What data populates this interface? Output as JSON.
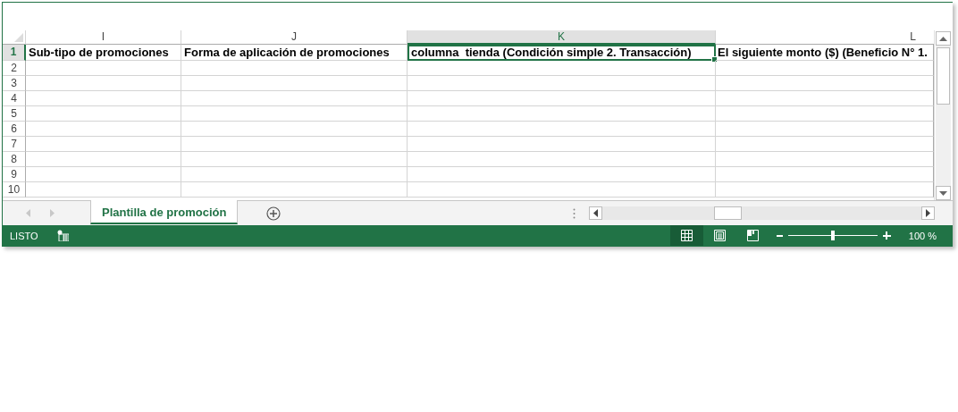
{
  "columns": [
    {
      "label": "I",
      "selected": false
    },
    {
      "label": "J",
      "selected": false
    },
    {
      "label": "K",
      "selected": true
    },
    {
      "label": "L",
      "selected": false
    }
  ],
  "rows": [
    {
      "number": "1",
      "selected": true,
      "cells": [
        {
          "text": "Sub-tipo de promociones",
          "selected": false
        },
        {
          "text": "Forma de aplicación de promociones",
          "selected": false
        },
        {
          "text": "columna  tienda (Condición simple 2. Transacción)",
          "selected": true
        },
        {
          "text": "El siguiente monto ($) (Beneficio N° 1.",
          "selected": false
        }
      ]
    },
    {
      "number": "2",
      "selected": false
    },
    {
      "number": "3",
      "selected": false
    },
    {
      "number": "4",
      "selected": false
    },
    {
      "number": "5",
      "selected": false
    },
    {
      "number": "6",
      "selected": false
    },
    {
      "number": "7",
      "selected": false
    },
    {
      "number": "8",
      "selected": false
    },
    {
      "number": "9",
      "selected": false
    },
    {
      "number": "10",
      "selected": false
    }
  ],
  "sheet_tabs": [
    {
      "label": "Plantilla de promoción",
      "selected": true
    }
  ],
  "status_bar": {
    "status": "LISTO",
    "views": [
      {
        "kind": "normal",
        "selected": true
      },
      {
        "kind": "page_layout",
        "selected": false
      },
      {
        "kind": "page_break",
        "selected": false
      }
    ],
    "zoom": {
      "level": 0.5,
      "reading": "100 %"
    }
  }
}
